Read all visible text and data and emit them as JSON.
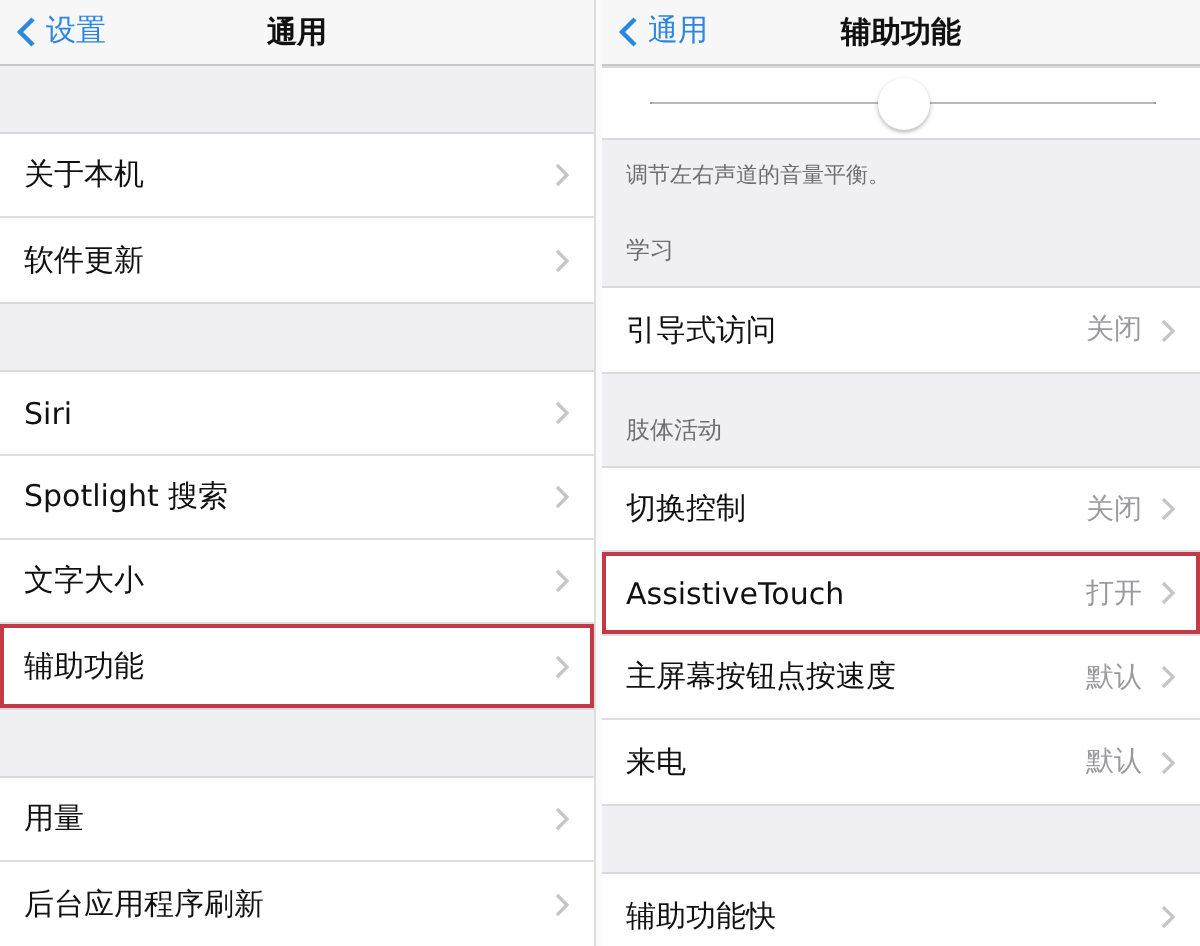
{
  "panels": [
    {
      "back": "设置",
      "title": "通用",
      "sections": [
        {
          "rows": [
            {
              "kind": "link",
              "label": "关于本机",
              "highlighted": false
            },
            {
              "kind": "link",
              "label": "软件更新",
              "highlighted": false
            }
          ]
        },
        {
          "rows": [
            {
              "kind": "link",
              "label": "Siri",
              "highlighted": false
            },
            {
              "kind": "link",
              "label": "Spotlight 搜索",
              "highlighted": false
            },
            {
              "kind": "link",
              "label": "文字大小",
              "highlighted": false
            },
            {
              "kind": "link",
              "label": "辅助功能",
              "highlighted": true
            }
          ]
        },
        {
          "rows": [
            {
              "kind": "link",
              "label": "用量",
              "highlighted": false
            },
            {
              "kind": "link",
              "label": "后台应用程序刷新",
              "highlighted": false
            }
          ]
        }
      ]
    },
    {
      "back": "通用",
      "title": "辅助功能",
      "sections": [
        {
          "rows": [
            {
              "kind": "slider",
              "level": 0.5
            }
          ],
          "footer": "调节左右声道的音量平衡。"
        },
        {
          "header": "学习",
          "rows": [
            {
              "kind": "link",
              "label": "引导式访问",
              "value": "关闭",
              "highlighted": false
            }
          ]
        },
        {
          "header": "肢体活动",
          "rows": [
            {
              "kind": "link",
              "label": "切换控制",
              "value": "关闭",
              "highlighted": false
            },
            {
              "kind": "link",
              "label": "AssistiveTouch",
              "value": "打开",
              "highlighted": true
            },
            {
              "kind": "link",
              "label": "主屏幕按钮点按速度",
              "value": "默认",
              "highlighted": false
            },
            {
              "kind": "link",
              "label": "来电",
              "value": "默认",
              "highlighted": false
            }
          ]
        },
        {
          "rows": [
            {
              "kind": "link",
              "label": "辅助功能快",
              "highlighted": false
            }
          ]
        }
      ]
    }
  ]
}
